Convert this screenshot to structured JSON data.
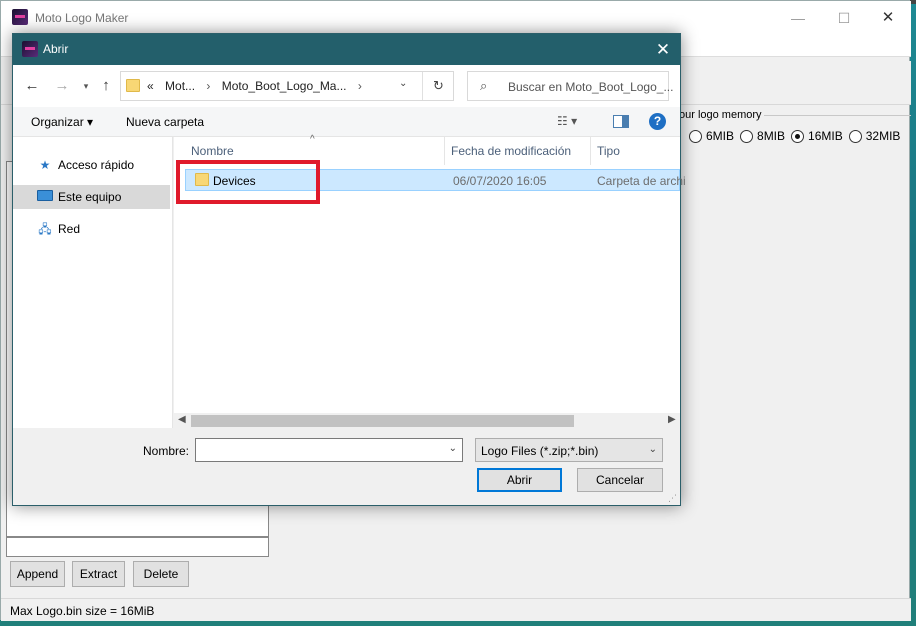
{
  "app": {
    "title": "Moto Logo Maker",
    "controls": {
      "minimize": "—",
      "maximize": "☐",
      "close": "✕"
    },
    "memory_group": {
      "legend": "our logo memory",
      "options": [
        "6MIB",
        "8MIB",
        "16MIB",
        "32MIB"
      ],
      "selected": "16MIB"
    },
    "buttons": {
      "append": "Append",
      "extract": "Extract",
      "delete": "Delete"
    },
    "status": "Max Logo.bin size = 16MiB"
  },
  "dialog": {
    "title": "Abrir",
    "close": "✕",
    "address": {
      "prefix": "«",
      "crumbs": [
        "Mot...",
        "Moto_Boot_Logo_Ma..."
      ],
      "separator": "›"
    },
    "search": {
      "placeholder": "Buscar en Moto_Boot_Logo_..."
    },
    "commands": {
      "organize": "Organizar ▾",
      "new_folder": "Nueva carpeta",
      "view": "☷ ▾",
      "help": "?"
    },
    "nav": [
      {
        "label": "Acceso rápido",
        "icon": "star-icon",
        "glyph": "★"
      },
      {
        "label": "Este equipo",
        "icon": "computer-icon",
        "glyph": ""
      },
      {
        "label": "Red",
        "icon": "network-icon",
        "glyph": "🖧"
      }
    ],
    "columns": {
      "name": "Nombre",
      "date": "Fecha de modificación",
      "type": "Tipo"
    },
    "files": [
      {
        "name": "Devices",
        "date": "06/07/2020 16:05",
        "type": "Carpeta de archi"
      }
    ],
    "filename_label": "Nombre:",
    "filename_value": "",
    "filetype": "Logo Files (*.zip;*.bin)",
    "buttons": {
      "open": "Abrir",
      "cancel": "Cancelar"
    }
  },
  "colors": {
    "dialog_titlebar": "#235f6b",
    "selection": "#cce8ff",
    "annotation": "#e01a2b",
    "accent": "#0078d7"
  }
}
